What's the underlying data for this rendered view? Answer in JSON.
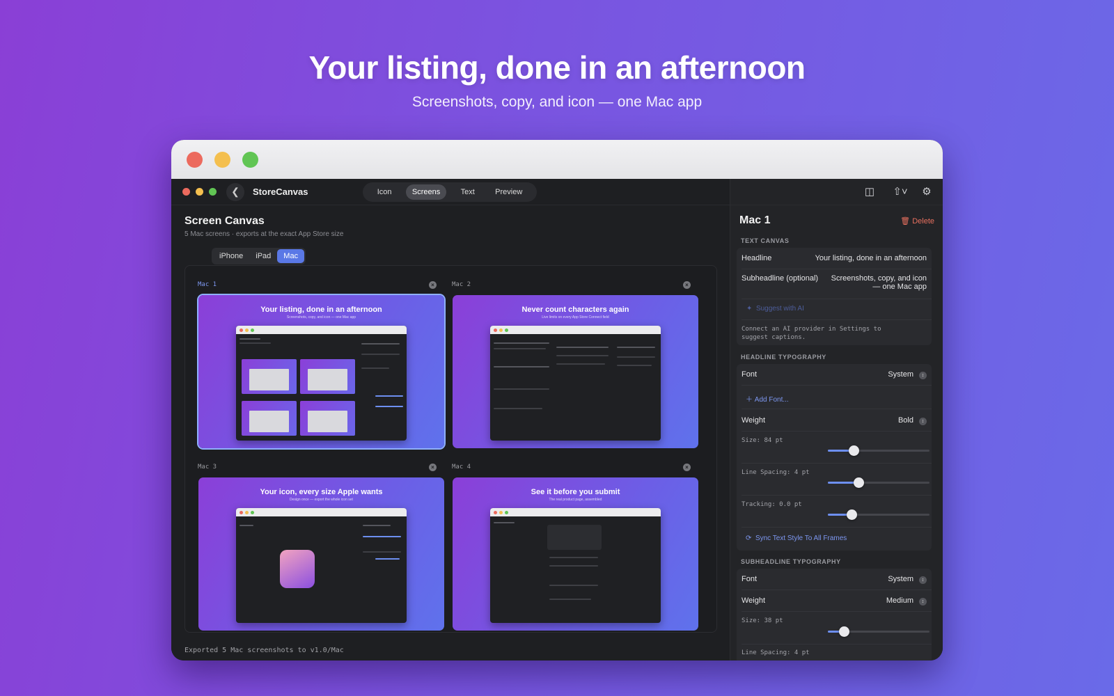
{
  "hero": {
    "title": "Your listing, done in an afternoon",
    "subtitle": "Screenshots, copy, and icon — one Mac app"
  },
  "colors": {
    "accent": "#5a78e6",
    "delete": "#e8705f",
    "dot_red": "#ec6a5e",
    "dot_yellow": "#f4bf4f",
    "dot_green": "#61c554"
  },
  "app": {
    "name": "StoreCanvas",
    "tabs": [
      "Icon",
      "Screens",
      "Text",
      "Preview"
    ],
    "active_tab": "Screens",
    "icons": [
      "back-icon",
      "sidebar-toggle-icon",
      "share-icon",
      "gear-icon"
    ]
  },
  "canvas": {
    "title": "Screen Canvas",
    "subtitle": "5 Mac screens · exports at the exact App Store size",
    "devices": [
      "iPhone",
      "iPad",
      "Mac"
    ],
    "active_device": "Mac",
    "frames": [
      {
        "label": "Mac 1",
        "title": "Your listing, done in an afternoon",
        "sub": "Screenshots, copy, and icon — one Mac app",
        "selected": true
      },
      {
        "label": "Mac 2",
        "title": "Never count characters again",
        "sub": "Live limits on every App Store Connect field",
        "selected": false
      },
      {
        "label": "Mac 3",
        "title": "Your icon, every size Apple wants",
        "sub": "Design once — export the whole icon set",
        "selected": false
      },
      {
        "label": "Mac 4",
        "title": "See it before you submit",
        "sub": "The real product page, assembled",
        "selected": false
      }
    ],
    "status": "Exported 5 Mac screenshots to v1.0/Mac"
  },
  "inspector": {
    "title": "Mac 1",
    "delete_label": "Delete",
    "text_canvas_label": "TEXT CANVAS",
    "headline_label": "Headline",
    "headline_value": "Your listing, done in an afternoon",
    "subheadline_label": "Subheadline (optional)",
    "subheadline_value": "Screenshots, copy, and icon — one Mac app",
    "suggest_label": "Suggest with AI",
    "ai_note": "Connect an AI provider in Settings to suggest captions.",
    "headline_typo_label": "HEADLINE TYPOGRAPHY",
    "font_label": "Font",
    "font_value": "System",
    "add_font_label": "Add Font...",
    "weight_label": "Weight",
    "weight_value": "Bold",
    "size_label": "Size: 84 pt",
    "size_level": 0.25,
    "spacing_label": "Line Spacing: 4 pt",
    "spacing_level": 0.3,
    "tracking_label": "Tracking: 0.0 pt",
    "tracking_level": 0.23,
    "sync_label": "Sync Text Style To All Frames",
    "sub_typo_label": "SUBHEADLINE TYPOGRAPHY",
    "sub_font_label": "Font",
    "sub_font_value": "System",
    "sub_weight_label": "Weight",
    "sub_weight_value": "Medium",
    "sub_size_label": "Size: 38 pt",
    "sub_size_level": 0.16,
    "sub_spacing_label": "Line Spacing: 4 pt"
  }
}
